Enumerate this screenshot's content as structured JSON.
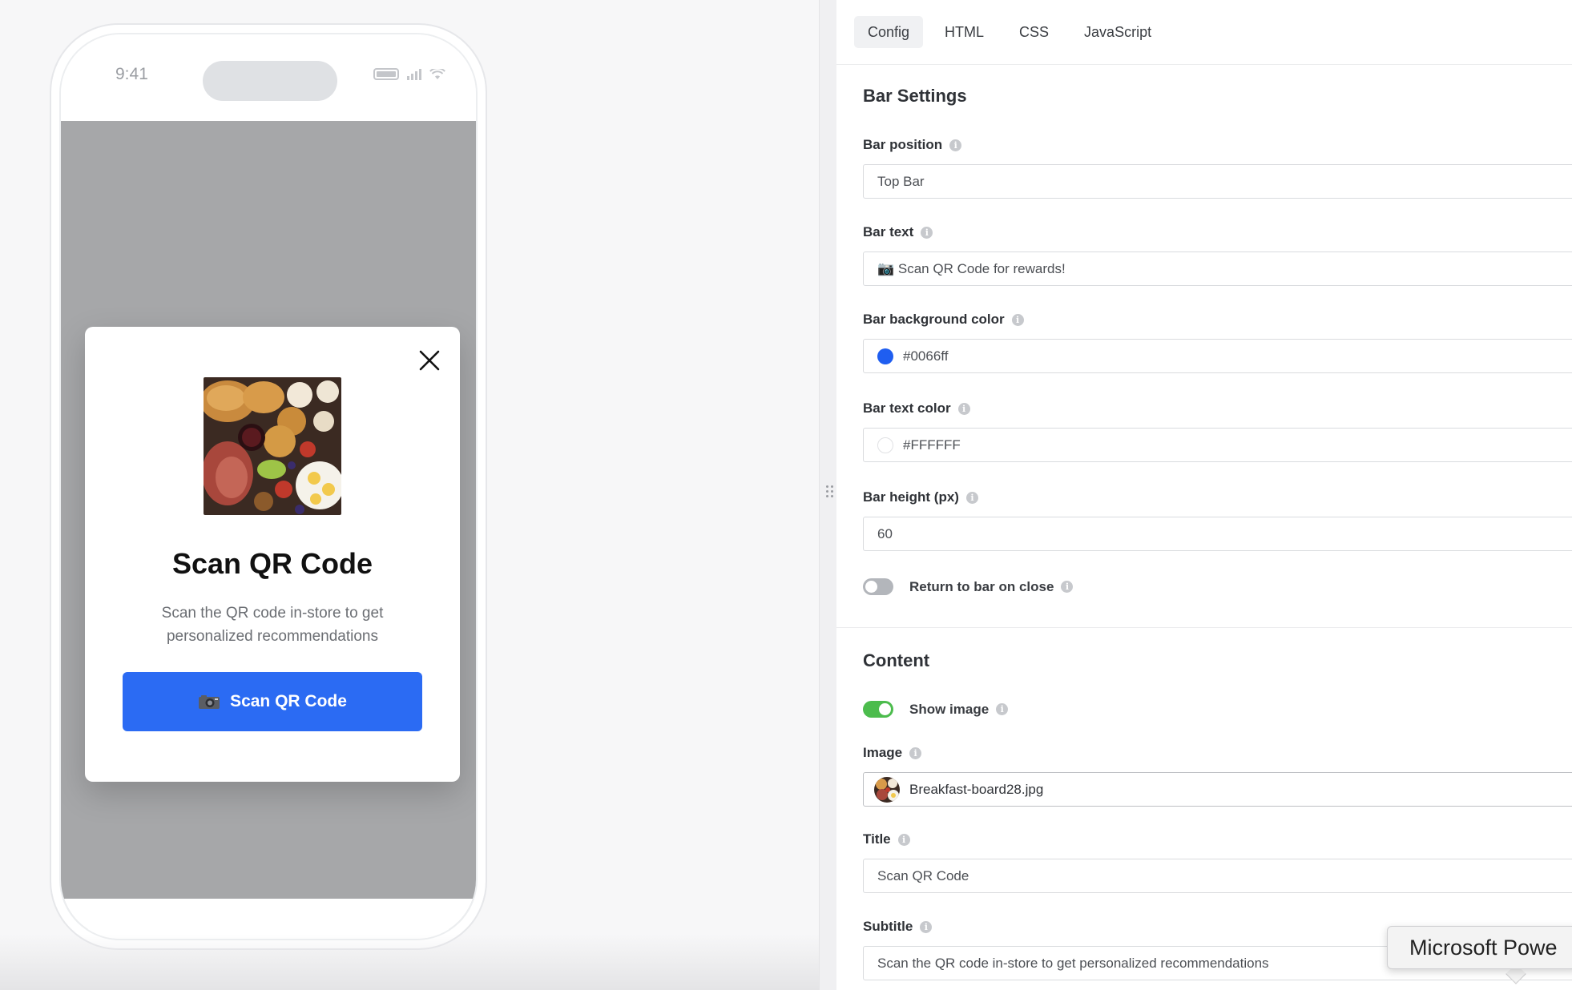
{
  "preview": {
    "status_time": "9:41",
    "popup": {
      "title": "Scan QR Code",
      "subtitle": "Scan the QR code in-store to get personalized recommendations",
      "button_label": "Scan QR Code",
      "image_alt": "Breakfast board"
    }
  },
  "tabs": [
    {
      "label": "Config",
      "active": true
    },
    {
      "label": "HTML",
      "active": false
    },
    {
      "label": "CSS",
      "active": false
    },
    {
      "label": "JavaScript",
      "active": false
    }
  ],
  "bar_settings": {
    "section_title": "Bar Settings",
    "bar_position": {
      "label": "Bar position",
      "value": "Top Bar"
    },
    "bar_text": {
      "label": "Bar text",
      "value": "📷 Scan QR Code for rewards!"
    },
    "bar_background_color": {
      "label": "Bar background color",
      "value": "#0066ff",
      "swatch": "#1f5ef0"
    },
    "bar_text_color": {
      "label": "Bar text color",
      "value": "#FFFFFF",
      "swatch": "#ffffff"
    },
    "bar_height": {
      "label": "Bar height (px)",
      "value": "60"
    },
    "return_to_bar": {
      "label": "Return to bar on close",
      "enabled": false
    }
  },
  "content": {
    "section_title": "Content",
    "show_image": {
      "label": "Show image",
      "enabled": true
    },
    "image": {
      "label": "Image",
      "value": "Breakfast-board28.jpg"
    },
    "title": {
      "label": "Title",
      "value": "Scan QR Code"
    },
    "subtitle": {
      "label": "Subtitle",
      "value": "Scan the QR code in-store to get personalized recommendations"
    }
  },
  "tooltip": {
    "text": "Microsoft Powe"
  },
  "colors": {
    "accent": "#2b6bf3",
    "toggle_on": "#4cbc4d",
    "toggle_off": "#b3b6bb"
  }
}
